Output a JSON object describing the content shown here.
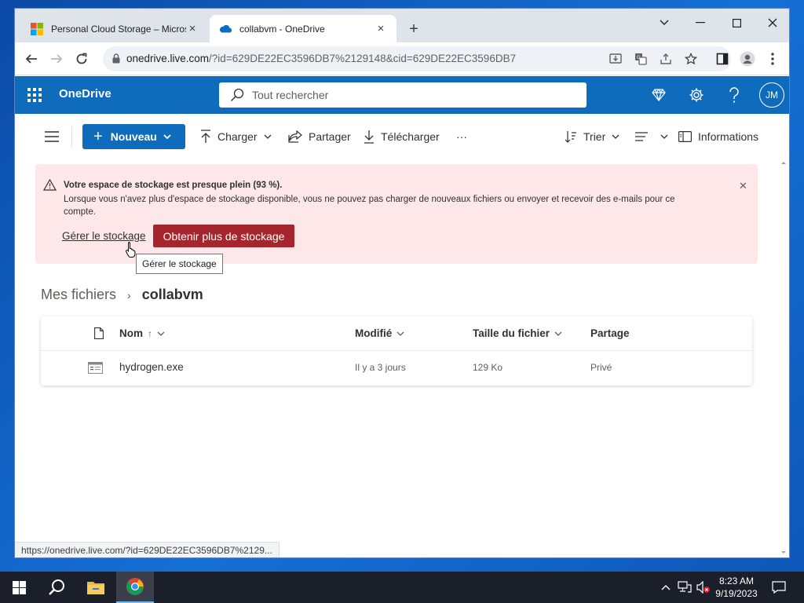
{
  "browser": {
    "tabs": [
      {
        "title": "Personal Cloud Storage – Microsoft"
      },
      {
        "title": "collabvm - OneDrive"
      }
    ],
    "url_host": "onedrive.live.com",
    "url_rest": "/?id=629DE22EC3596DB7%2129148&cid=629DE22EC3596DB7",
    "status_url": "https://onedrive.live.com/?id=629DE22EC3596DB7%2129..."
  },
  "onedrive": {
    "brand": "OneDrive",
    "search_placeholder": "Tout rechercher",
    "avatar_initials": "JM"
  },
  "commands": {
    "new_label": "Nouveau",
    "upload": "Charger",
    "share": "Partager",
    "download": "Télécharger",
    "more": "···",
    "sort": "Trier",
    "info": "Informations"
  },
  "notice": {
    "title": "Votre espace de stockage est presque plein (93 %).",
    "body": "Lorsque vous n'avez plus d'espace de stockage disponible, vous ne pouvez pas charger de nouveaux fichiers ou envoyer et recevoir des e-mails pour ce compte.",
    "manage_link": "Gérer le stockage",
    "get_more_button": "Obtenir plus de stockage",
    "tooltip": "Gérer le stockage",
    "accent": "#a4262c",
    "background": "#fde7e9"
  },
  "breadcrumb": {
    "root": "Mes fichiers",
    "current": "collabvm"
  },
  "files": {
    "columns": {
      "name": "Nom",
      "name_sort": "↑",
      "modified": "Modifié",
      "size": "Taille du fichier",
      "sharing": "Partage"
    },
    "rows": [
      {
        "name": "hydrogen.exe",
        "modified": "Il y a 3 jours",
        "size": "129 Ko",
        "sharing": "Privé"
      }
    ]
  },
  "taskbar": {
    "time": "8:23 AM",
    "date": "9/19/2023"
  },
  "colors": {
    "onedrive_blue": "#0f6cbd",
    "desktop_blue": "#1570d6"
  }
}
